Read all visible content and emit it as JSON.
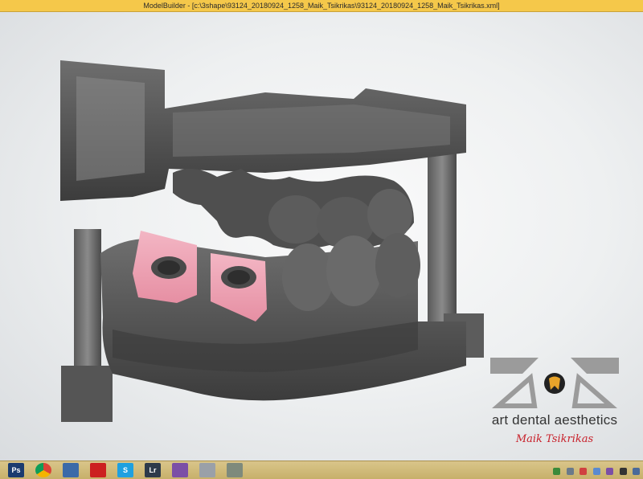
{
  "window": {
    "title": "ModelBuilder - [c:\\3shape\\93124_20180924_1258_Maik_Tsikrikas\\93124_20180924_1258_Maik_Tsikrikas.xml]"
  },
  "logo": {
    "brand": "art dental aesthetics",
    "signature": "Maik Tsikrikas"
  },
  "taskbar": {
    "apps": [
      {
        "name": "photoshop",
        "label": "Ps",
        "color": "#1b3b6f"
      },
      {
        "name": "chrome",
        "label": "",
        "color": "#e8e8e8"
      },
      {
        "name": "thunderbird",
        "label": "",
        "color": "#3b6aa8"
      },
      {
        "name": "red-app",
        "label": "",
        "color": "#cc2020"
      },
      {
        "name": "skype",
        "label": "S",
        "color": "#1ea0e0"
      },
      {
        "name": "lightroom",
        "label": "Lr",
        "color": "#2d3a4a"
      },
      {
        "name": "viber",
        "label": "",
        "color": "#7b4fa6"
      },
      {
        "name": "network",
        "label": "",
        "color": "#9aa0a8"
      },
      {
        "name": "modelbuilder",
        "label": "",
        "color": "#7e8a7c"
      }
    ]
  }
}
